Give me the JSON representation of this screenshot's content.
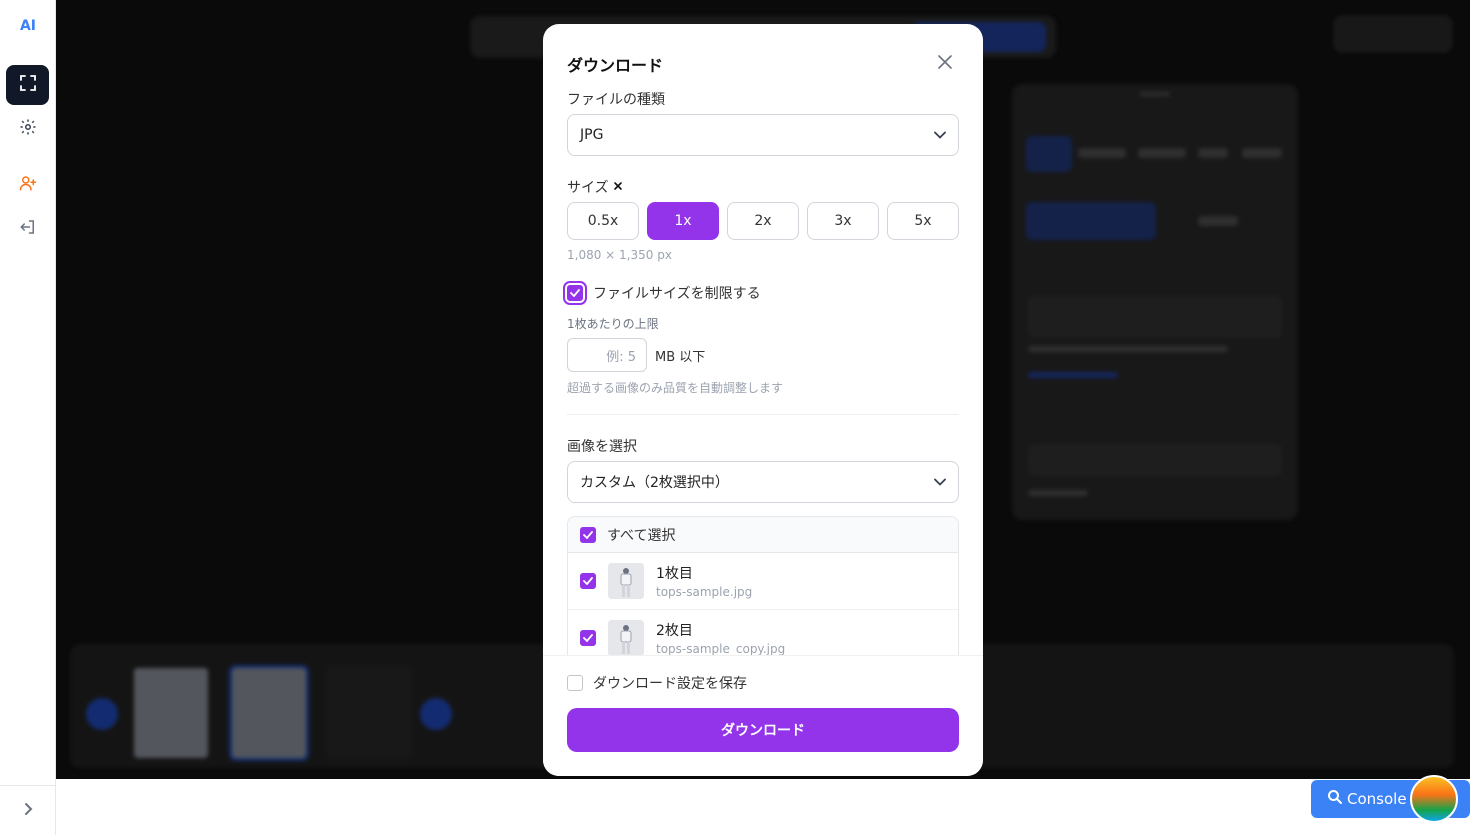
{
  "sidebar": {
    "logo": "AI",
    "items": [
      {
        "icon": "fullscreen-icon"
      },
      {
        "icon": "gear-icon"
      },
      {
        "icon": "add-user-icon"
      },
      {
        "icon": "logout-icon"
      }
    ],
    "expand_icon": "chevron-right-icon"
  },
  "modal": {
    "title": "ダウンロード",
    "file_type_label": "ファイルの種類",
    "file_type_value": "JPG",
    "size_label": "サイズ",
    "size_options": [
      "0.5x",
      "1x",
      "2x",
      "3x",
      "5x"
    ],
    "size_selected": "1x",
    "dimensions": "1,080 × 1,350 px",
    "limit_checkbox_label": "ファイルサイズを制限する",
    "per_image_label": "1枚あたりの上限",
    "mb_placeholder": "例: 5",
    "mb_unit": "MB 以下",
    "limit_hint": "超過する画像のみ品質を自動調整します",
    "image_select_label": "画像を選択",
    "image_select_value": "カスタム（2枚選択中）",
    "select_all_label": "すべて選択",
    "images": [
      {
        "name": "1枚目",
        "file": "tops-sample.jpg"
      },
      {
        "name": "2枚目",
        "file": "tops-sample_copy.jpg"
      }
    ],
    "save_settings_label": "ダウンロード設定を保存",
    "download_button": "ダウンロード"
  },
  "console": {
    "label": "Console"
  },
  "colors": {
    "accent": "#9333ea",
    "blue": "#3b82f6",
    "sidebar_active": "#111827"
  }
}
